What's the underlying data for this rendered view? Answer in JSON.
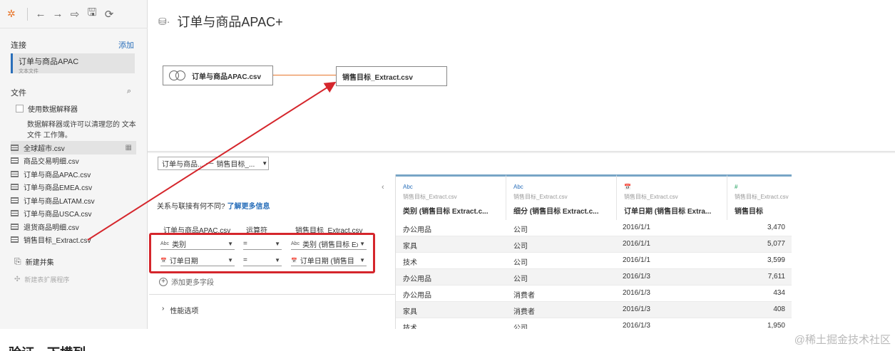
{
  "toolbar": {
    "logo": "✲",
    "back": "←",
    "forward": "→",
    "redo": "⇨",
    "save": "🖫",
    "refresh": "⟳"
  },
  "connections": {
    "title": "连接",
    "add": "添加",
    "item_name": "订单与商品APAC",
    "item_type": "文本文件"
  },
  "files": {
    "title": "文件",
    "interpreter_label": "使用数据解释器",
    "interpreter_desc": "数据解释器或许可以清理您的 文本文件 工作簿。",
    "items": [
      {
        "label": "全球超市.csv",
        "extra": "▦"
      },
      {
        "label": "商品交易明细.csv",
        "extra": ""
      },
      {
        "label": "订单与商品APAC.csv",
        "extra": ""
      },
      {
        "label": "订单与商品EMEA.csv",
        "extra": ""
      },
      {
        "label": "订单与商品LATAM.csv",
        "extra": ""
      },
      {
        "label": "订单与商品USCA.csv",
        "extra": ""
      },
      {
        "label": "退货商品明细.csv",
        "extra": ""
      },
      {
        "label": "销售目标_Extract.csv",
        "extra": ""
      }
    ],
    "new_union": "新建并集",
    "new_extension": "新建表扩展程序"
  },
  "canvas": {
    "title": "订单与商品APAC+",
    "left_table": "订单与商品APAC.csv",
    "right_table": "销售目标_Extract.csv"
  },
  "join": {
    "selector_left": "订单与商品...",
    "selector_right": "销售目标_...",
    "info": "关系与联接有何不同?",
    "info_link": "了解更多信息",
    "col_left": "订单与商品APAC.csv",
    "col_op": "运算符",
    "col_right": "销售目标_Extract.csv",
    "clauses": [
      {
        "left_type": "Abc",
        "left": "类别",
        "op": "=",
        "right_type": "Abc",
        "right": "类别 (销售目标 Ex"
      },
      {
        "left_type": "📅",
        "left": "订单日期",
        "op": "=",
        "right_type": "📅",
        "right": "订单日期 (销售目"
      }
    ],
    "add_more": "添加更多字段",
    "performance": "性能选项"
  },
  "grid": {
    "columns": [
      {
        "type": "Abc",
        "source": "销售目标_Extract.csv",
        "name": "类别 (销售目标 Extract.c..."
      },
      {
        "type": "Abc",
        "source": "销售目标_Extract.csv",
        "name": "细分 (销售目标 Extract.c..."
      },
      {
        "type": "📅",
        "source": "销售目标_Extract.csv",
        "name": "订单日期 (销售目标 Extra..."
      },
      {
        "type": "#",
        "source": "销售目标_Extract.csv",
        "name": "销售目标"
      }
    ],
    "rows": [
      [
        "办公用品",
        "公司",
        "2016/1/1",
        "3,470"
      ],
      [
        "家具",
        "公司",
        "2016/1/1",
        "5,077"
      ],
      [
        "技术",
        "公司",
        "2016/1/1",
        "3,599"
      ],
      [
        "办公用品",
        "公司",
        "2016/1/3",
        "7,611"
      ],
      [
        "办公用品",
        "消费者",
        "2016/1/3",
        "434"
      ],
      [
        "家具",
        "消费者",
        "2016/1/3",
        "408"
      ],
      [
        "技术",
        "公司",
        "2016/1/3",
        "1,950"
      ]
    ]
  },
  "watermark": "@稀土掘金技术社区",
  "bottom_text": "验证一下横列",
  "colors": {
    "accent": "#2a6fba",
    "highlight": "#d5262c",
    "join_line": "#e8762b"
  }
}
